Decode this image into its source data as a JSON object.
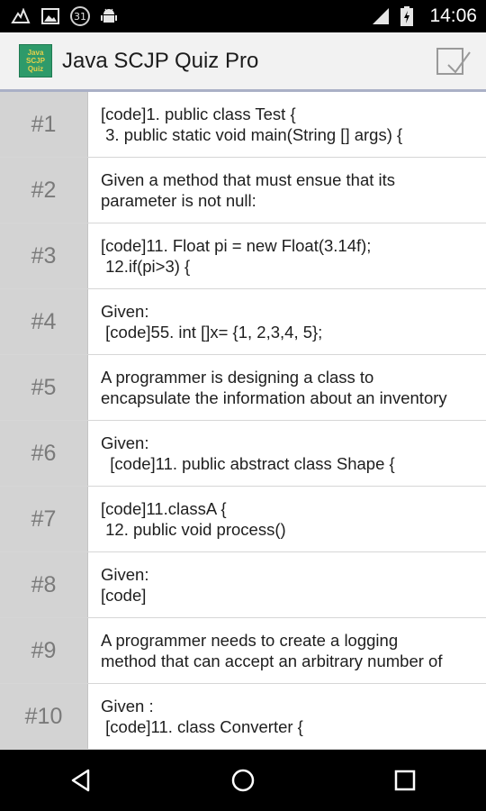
{
  "status_bar": {
    "time": "14:06",
    "notification_badge": "31",
    "icons": [
      "bird-icon",
      "image-icon",
      "calendar-badge-icon",
      "android-icon",
      "signal-icon",
      "battery-icon"
    ]
  },
  "app_bar": {
    "title": "Java SCJP Quiz Pro",
    "logo_lines": [
      "Java",
      "SCJP",
      "Quiz"
    ],
    "logo_color": "#2e9a6a",
    "action_icon": "checkbox-icon"
  },
  "questions": [
    {
      "number": "#1",
      "line1": "[code]1. public class Test {",
      "line2": " 3. public static void main(String [] args) {"
    },
    {
      "number": "#2",
      "line1": "Given a method that must ensue that its",
      "line2": "parameter is not null:"
    },
    {
      "number": "#3",
      "line1": "[code]11. Float pi = new Float(3.14f);",
      "line2": " 12.if(pi>3) {"
    },
    {
      "number": "#4",
      "line1": "Given:",
      "line2": " [code]55. int []x= {1, 2,3,4, 5};"
    },
    {
      "number": "#5",
      "line1": "A programmer is designing a class to",
      "line2": "encapsulate the information about an inventory"
    },
    {
      "number": "#6",
      "line1": "Given:",
      "line2": "  [code]11. public abstract class Shape {"
    },
    {
      "number": "#7",
      "line1": "[code]11.classA {",
      "line2": " 12. public void process()"
    },
    {
      "number": "#8",
      "line1": "Given:",
      "line2": "[code]"
    },
    {
      "number": "#9",
      "line1": "A programmer needs to create a logging",
      "line2": "method that can accept an arbitrary number of"
    },
    {
      "number": "#10",
      "line1": "Given :",
      "line2": " [code]11. class Converter {"
    }
  ],
  "nav_bar": {
    "buttons": [
      "back-icon",
      "home-icon",
      "recents-icon"
    ]
  }
}
